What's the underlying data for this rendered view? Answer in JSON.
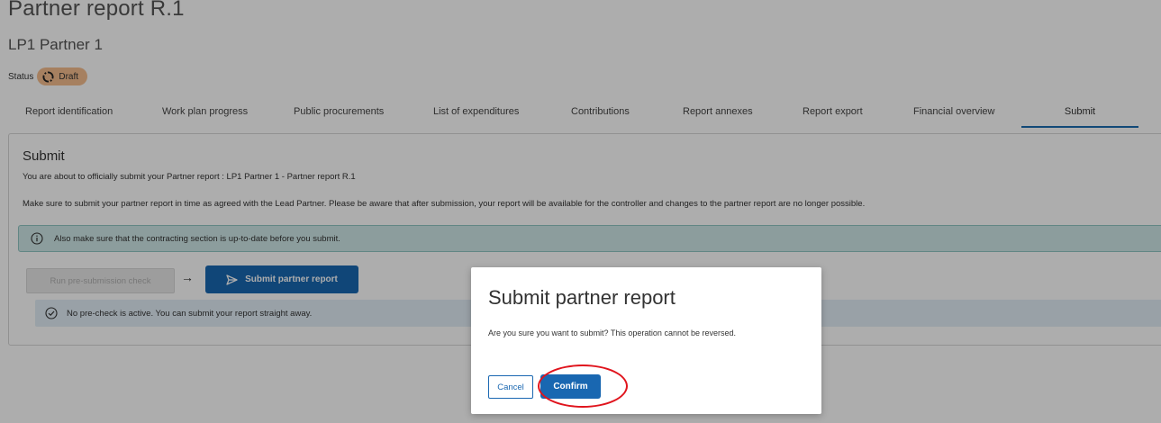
{
  "header": {
    "title": "Partner report R.1",
    "subtitle": "LP1 Partner 1",
    "status_label": "Status",
    "status_value": "Draft"
  },
  "tabs": [
    {
      "label": "Report identification"
    },
    {
      "label": "Work plan progress"
    },
    {
      "label": "Public procurements"
    },
    {
      "label": "List of expenditures"
    },
    {
      "label": "Contributions"
    },
    {
      "label": "Report annexes"
    },
    {
      "label": "Report export"
    },
    {
      "label": "Financial overview"
    },
    {
      "label": "Submit",
      "active": true
    }
  ],
  "submit_section": {
    "title": "Submit",
    "intro": "You are about to officially submit your Partner report : LP1 Partner 1 - Partner report R.1",
    "instructions": "Make sure to submit your partner report in time as agreed with the Lead Partner. Please be aware that after submission, your report will be available for the controller and changes to the partner report are no longer possible.",
    "info_message": "Also make sure that the contracting section is up-to-date before you submit.",
    "precheck_button": "Run pre-submission check",
    "arrow": "→",
    "submit_button": "Submit partner report",
    "precheck_status": "No pre-check is active. You can submit your report straight away."
  },
  "dialog": {
    "title": "Submit partner report",
    "message": "Are you sure you want to submit? This operation cannot be reversed.",
    "cancel_label": "Cancel",
    "confirm_label": "Confirm"
  },
  "colors": {
    "primary": "#1967b1",
    "status_badge": "#f5bd8e",
    "info_box": "#cfe8e7",
    "ok_box": "#e2eef7",
    "highlight": "#e0141d"
  },
  "icons": {
    "status": "draft-icon",
    "info": "info-icon",
    "submit": "send-icon",
    "precheck": "check-circle-icon"
  }
}
